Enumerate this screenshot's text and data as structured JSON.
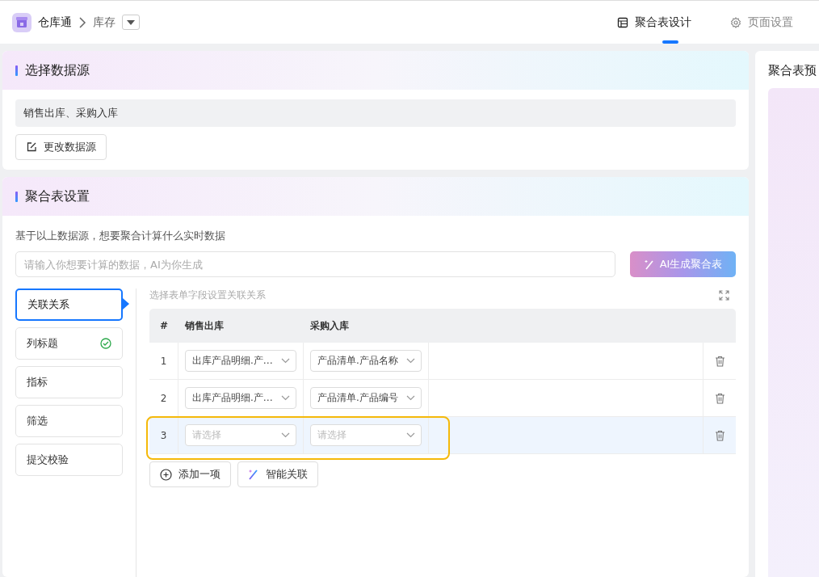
{
  "header": {
    "app_name": "仓库通",
    "breadcrumb": "库存",
    "tabs": [
      {
        "label": "聚合表设计",
        "selected": true
      },
      {
        "label": "页面设置",
        "selected": false
      }
    ]
  },
  "source_card": {
    "title": "选择数据源",
    "sources": "销售出库、采购入库",
    "change_button": "更改数据源"
  },
  "settings_card": {
    "title": "聚合表设置",
    "prompt_label": "基于以上数据源，想要聚合计算什么实时数据",
    "prompt_placeholder": "请输入你想要计算的数据，AI为你生成",
    "ai_button": "AI生成聚合表",
    "steps": [
      {
        "label": "关联关系",
        "selected": true,
        "done": false
      },
      {
        "label": "列标题",
        "selected": false,
        "done": true
      },
      {
        "label": "指标",
        "selected": false,
        "done": false
      },
      {
        "label": "筛选",
        "selected": false,
        "done": false
      },
      {
        "label": "提交校验",
        "selected": false,
        "done": false
      }
    ],
    "hint": "选择表单字段设置关联关系",
    "table": {
      "columns": [
        "#",
        "销售出库",
        "采购入库"
      ],
      "rows": [
        {
          "index": "1",
          "left": {
            "value": "出库产品明细.产…"
          },
          "right": {
            "value": "产品清单.产品名称"
          },
          "highlighted": false
        },
        {
          "index": "2",
          "left": {
            "value": "出库产品明细.产…"
          },
          "right": {
            "value": "产品清单.产品编号"
          },
          "highlighted": false
        },
        {
          "index": "3",
          "left": {
            "placeholder": "请选择"
          },
          "right": {
            "placeholder": "请选择"
          },
          "highlighted": true
        }
      ]
    },
    "add_button": "添加一项",
    "smart_button": "智能关联"
  },
  "preview_panel": {
    "title": "聚合表预"
  }
}
